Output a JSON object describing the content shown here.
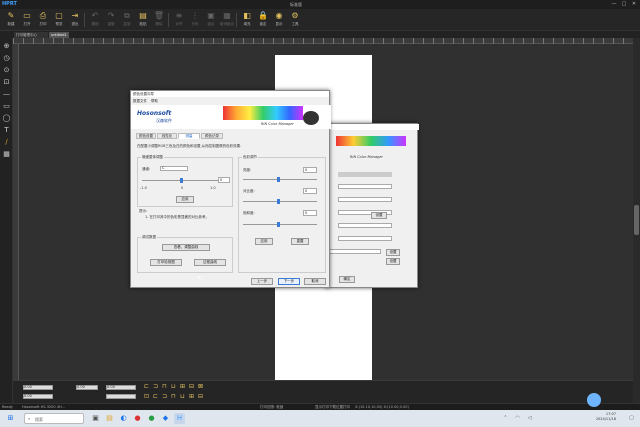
{
  "app": {
    "logo": "HPRT",
    "title": "标准版"
  },
  "window_controls": [
    "—",
    "□",
    "✕"
  ],
  "toolbar": [
    {
      "label": "新建",
      "icon": "✎",
      "dim": false
    },
    {
      "label": "打开",
      "icon": "▭",
      "dim": false
    },
    {
      "label": "打印",
      "icon": "⎙",
      "dim": false
    },
    {
      "label": "预览",
      "icon": "▢",
      "dim": false
    },
    {
      "label": "退出",
      "icon": "⇥",
      "dim": false
    },
    {
      "label": "撤销",
      "icon": "↶",
      "dim": true
    },
    {
      "label": "重做",
      "icon": "↷",
      "dim": true
    },
    {
      "label": "复制",
      "icon": "⧉",
      "dim": true
    },
    {
      "label": "粘贴",
      "icon": "▤",
      "dim": false
    },
    {
      "label": "删除",
      "icon": "🗑",
      "dim": true
    },
    {
      "label": "对齐",
      "icon": "≡",
      "dim": true
    },
    {
      "label": "分布",
      "icon": "⋮",
      "dim": true
    },
    {
      "label": "组合",
      "icon": "▣",
      "dim": true
    },
    {
      "label": "取消组合",
      "icon": "▦",
      "dim": true
    },
    {
      "label": "填充",
      "icon": "◧",
      "dim": false
    },
    {
      "label": "锁定",
      "icon": "🔒",
      "dim": false
    },
    {
      "label": "显示",
      "icon": "◉",
      "dim": false
    },
    {
      "label": "工具",
      "icon": "⚙",
      "dim": false
    }
  ],
  "tabs": [
    {
      "label": "打印管理中心",
      "active": false
    },
    {
      "label": "untitled1",
      "active": true
    }
  ],
  "left_tools": [
    "⊕",
    "◷",
    "⊙",
    "⊡",
    "—",
    "▭",
    "◯",
    "T",
    "∕",
    "▦"
  ],
  "dialog_main": {
    "title": "颜色设置向导",
    "menu": [
      "数据文件",
      "帮助"
    ],
    "brand_name": "Hosonsoft",
    "brand_cn": "汉森软件",
    "brand_tag": "RIN Color Manager",
    "tabs": [
      {
        "label": "颜色设置",
        "active": false
      },
      {
        "label": "线性化",
        "active": false
      },
      {
        "label": "测量",
        "active": true
      },
      {
        "label": "颜色记录",
        "active": false
      }
    ],
    "description": "在配置小调整RGB三色及白的颜色和设置,从而控制图像的色彩效果.",
    "left_group": {
      "title": "微细整体调整",
      "channel_label": "通道:",
      "channel_value": "C",
      "slider_value": "0",
      "tick_min": "-1.0",
      "tick_mid": "0",
      "tick_max": "1.0",
      "apply": "应用"
    },
    "tip": {
      "heading": "提示:",
      "text": "1. 在打印其中的色彩是显著的对比参考。"
    },
    "ops_group": {
      "title": "调试数据",
      "view_button": "查看、调整曲线",
      "btn_a": "打印检测图",
      "btn_b": "过程曲线"
    },
    "right_group": {
      "title": "色彩调节",
      "rows": [
        {
          "label": "亮度:",
          "value": "0"
        },
        {
          "label": "对比度:",
          "value": "0"
        },
        {
          "label": "饱和度:",
          "value": "0"
        }
      ],
      "apply": "应用",
      "reset": "重置"
    },
    "nav": {
      "back": "上一步",
      "next": "下一步",
      "cancel": "取消"
    }
  },
  "dialog_back": {
    "brand_tag": "RIN Color Manager",
    "buttons": [
      "设置",
      "设置",
      "确定",
      "取消"
    ]
  },
  "bottom_props": {
    "fields": [
      "0.00",
      "0.00",
      "0.00",
      "0.00"
    ]
  },
  "status": {
    "left": "Ready",
    "printer": "Hosonsoft HS-3200 4H...",
    "mid": "打印回馈: 就绪",
    "right": "显示打印下载位置打印",
    "coords": "X:(15.10,10.00) X:(10.00,0.00)"
  },
  "taskbar": {
    "search": "搜索",
    "time": "17:07",
    "date": "2024/11/18"
  }
}
